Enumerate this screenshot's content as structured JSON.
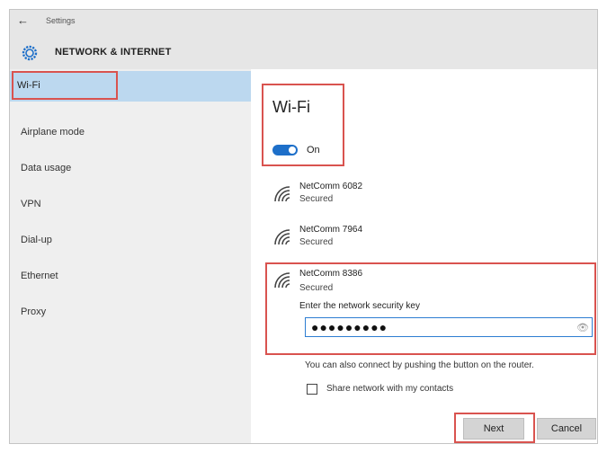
{
  "header": {
    "back_glyph": "←",
    "app_title": "Settings",
    "page_title": "NETWORK & INTERNET",
    "icon": "gear-icon"
  },
  "sidebar": {
    "items": [
      {
        "label": "Wi-Fi",
        "selected": true
      },
      {
        "label": "Airplane mode"
      },
      {
        "label": "Data usage"
      },
      {
        "label": "VPN"
      },
      {
        "label": "Dial-up"
      },
      {
        "label": "Ethernet"
      },
      {
        "label": "Proxy"
      }
    ]
  },
  "wifi": {
    "title": "Wi-Fi",
    "toggle_label": "On",
    "toggle_on": true,
    "networks": [
      {
        "name": "NetComm 6082",
        "status": "Secured",
        "icon": "wifi-signal-icon"
      },
      {
        "name": "NetComm 7964",
        "status": "Secured",
        "icon": "wifi-signal-icon"
      },
      {
        "name": "NetComm 8386",
        "status": "Secured",
        "icon": "wifi-signal-icon"
      }
    ],
    "key_label": "Enter the network security key",
    "password_value": "●●●●●●●●●",
    "router_hint": "You can also connect by pushing the button on the router.",
    "share_label": "Share network with my contacts",
    "share_checked": false,
    "next_label": "Next",
    "cancel_label": "Cancel"
  },
  "colors": {
    "accent": "#1d6fc9",
    "highlight": "#d9534f",
    "sidebar_selected": "#bcd8ef"
  }
}
